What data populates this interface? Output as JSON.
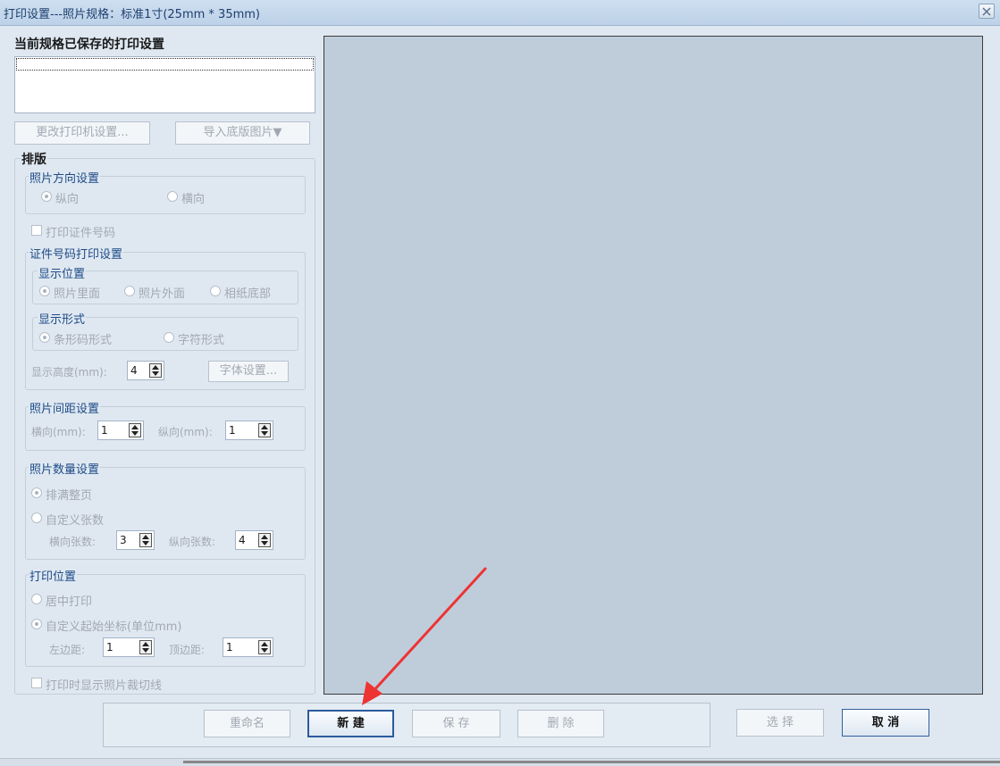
{
  "window": {
    "title": "打印设置---照片规格：标准1寸(25mm * 35mm)"
  },
  "saved": {
    "header": "当前规格已保存的打印设置"
  },
  "buttons": {
    "change_printer": "更改打印机设置...",
    "import_base": "导入底版图片▼",
    "font_settings": "字体设置...",
    "rename": "重命名",
    "new": "新 建",
    "save": "保 存",
    "delete": "删 除",
    "select": "选 择",
    "cancel": "取 消"
  },
  "layout": {
    "header": "排版",
    "orientation": {
      "title": "照片方向设置",
      "portrait": "纵向",
      "landscape": "横向",
      "selected": "纵向"
    },
    "print_id": {
      "label": "打印证件号码",
      "checked": false
    },
    "id_print": {
      "title": "证件号码打印设置",
      "position": {
        "title": "显示位置",
        "options": [
          "照片里面",
          "照片外面",
          "相纸底部"
        ],
        "selected": "照片里面"
      },
      "format": {
        "title": "显示形式",
        "options": [
          "条形码形式",
          "字符形式"
        ],
        "selected": "条形码形式"
      },
      "height_label": "显示高度(mm):",
      "height_value": "4"
    },
    "spacing": {
      "title": "照片间距设置",
      "h_label": "横向(mm):",
      "h_value": "1",
      "v_label": "纵向(mm):",
      "v_value": "1"
    },
    "count": {
      "title": "照片数量设置",
      "fill_page": "排满整页",
      "custom": "自定义张数",
      "selected": "排满整页",
      "h_label": "横向张数:",
      "h_value": "3",
      "v_label": "纵向张数:",
      "v_value": "4"
    },
    "position": {
      "title": "打印位置",
      "center": "居中打印",
      "custom": "自定义起始坐标(单位mm)",
      "selected": "自定义起始坐标(单位mm)",
      "left_label": "左边距:",
      "left_value": "1",
      "top_label": "顶边距:",
      "top_value": "1"
    },
    "show_cut": {
      "label": "打印时显示照片裁切线",
      "checked": false
    }
  },
  "colors": {
    "preview_bg": "#bfcddb",
    "title_text": "#1d3f6e",
    "annotation_arrow": "#ee3333"
  },
  "icons": {
    "close": "close-icon",
    "spinner": "spinner-arrows-icon"
  }
}
